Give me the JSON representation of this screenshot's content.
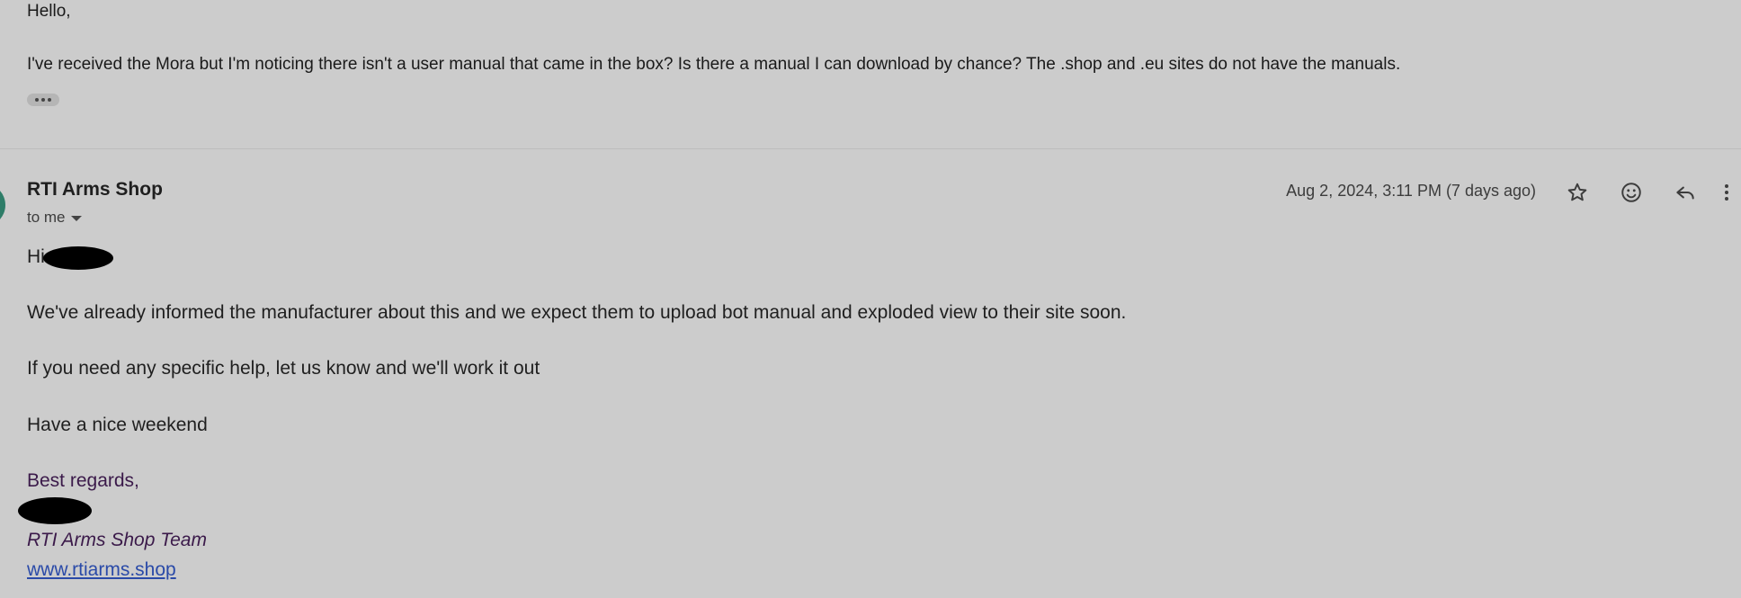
{
  "quoted": {
    "greeting": "Hello,",
    "body": "I've received the Mora but I'm noticing there isn't a user manual that came in the box? Is there a manual I can download by chance? The .shop and .eu sites do not have the manuals."
  },
  "message": {
    "sender": "RTI Arms Shop",
    "recipient": "to me",
    "date": "Aug 2, 2024, 3:11 PM (7 days ago)",
    "greeting": "Hi",
    "paragraphs": [
      "We've already informed the manufacturer about this and we expect them to upload bot manual and exploded view to their site soon.",
      "If you need any specific help, let us know and we'll work it out",
      "Have a nice weekend"
    ],
    "signoff": "Best regards,",
    "team": "RTI Arms Shop Team",
    "website": "www.rtiarms.shop"
  },
  "colors": {
    "background": "#cccccc",
    "avatar": "#2e7d68",
    "signature": "#3b1a4a",
    "link": "#2a4aa8"
  },
  "icons": [
    "star-icon",
    "emoji-icon",
    "reply-icon",
    "more-vert-icon"
  ]
}
